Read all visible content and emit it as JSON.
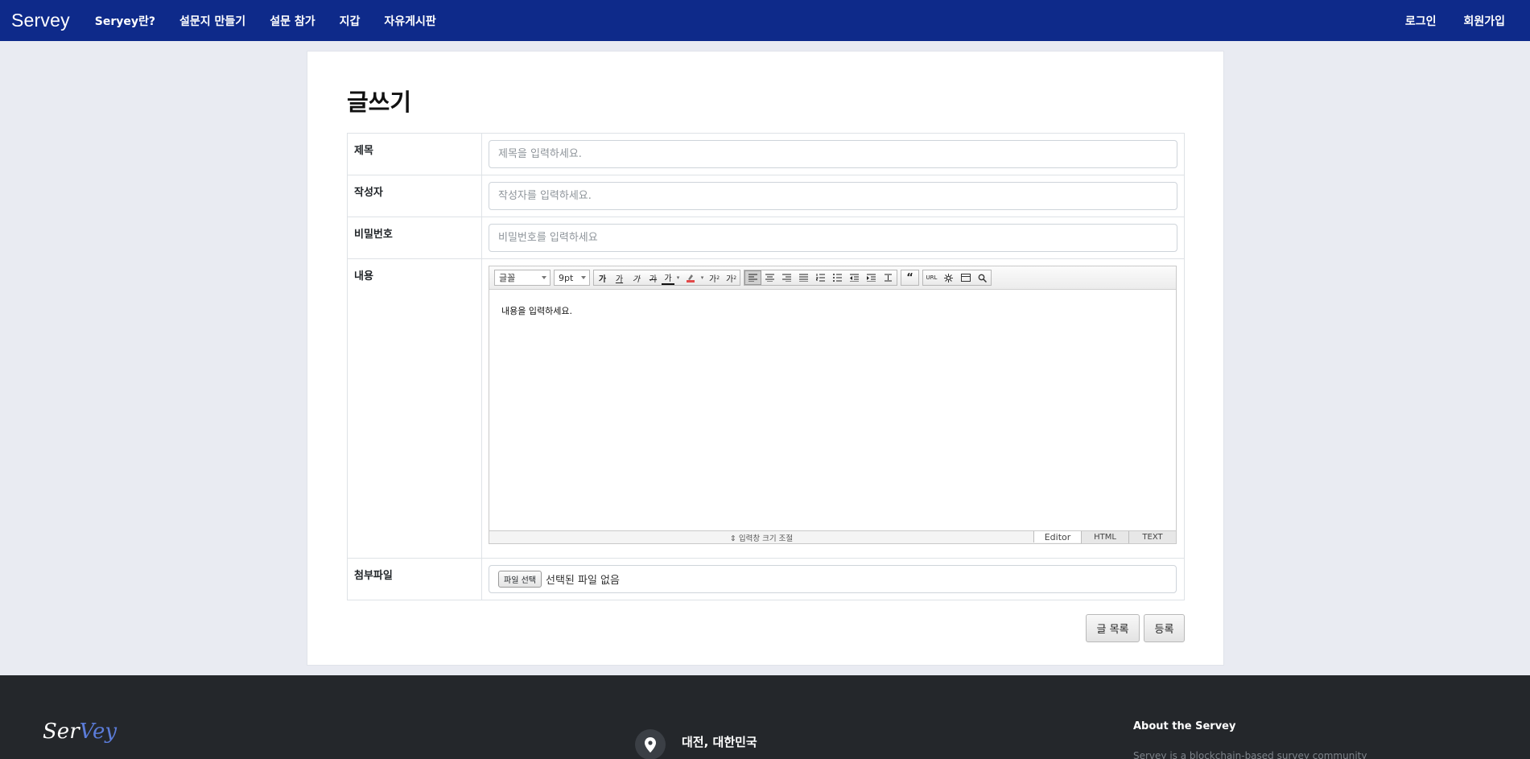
{
  "navbar": {
    "brand": "Servey",
    "links": [
      "Seryey란?",
      "설문지 만들기",
      "설문 참가",
      "지갑",
      "자유게시판"
    ],
    "right_links": [
      "로그인",
      "회원가입"
    ],
    "bg_color": "#0e2a8a"
  },
  "page": {
    "title": "글쓰기"
  },
  "form": {
    "title_label": "제목",
    "title_placeholder": "제목을 입력하세요.",
    "author_label": "작성자",
    "author_placeholder": "작성자를 입력하세요.",
    "password_label": "비밀번호",
    "password_placeholder": "비밀번호를 입력하세요",
    "content_label": "내용",
    "attachment_label": "첨부파일",
    "file_button": "파일 선택",
    "file_status": "선택된 파일 없음"
  },
  "editor": {
    "font_select": "글꼴",
    "size_select": "9pt",
    "content_placeholder": "내용을 입력하세요.",
    "resize_label": "⇕ 입력창 크기 조절",
    "modes": [
      "Editor",
      "HTML",
      "TEXT"
    ],
    "style_buttons": [
      "가",
      "가",
      "가",
      "가",
      "가"
    ],
    "script_buttons": [
      "가",
      "가"
    ],
    "url_label": "URL"
  },
  "buttons": {
    "list": "글 목록",
    "submit": "등록"
  },
  "footer": {
    "logo_main": "Ser",
    "logo_accent": "Vey",
    "location": "대전, 대한민국",
    "about_title": "About the Servey",
    "about_text": "Servey is a blockchain-based survey community"
  }
}
